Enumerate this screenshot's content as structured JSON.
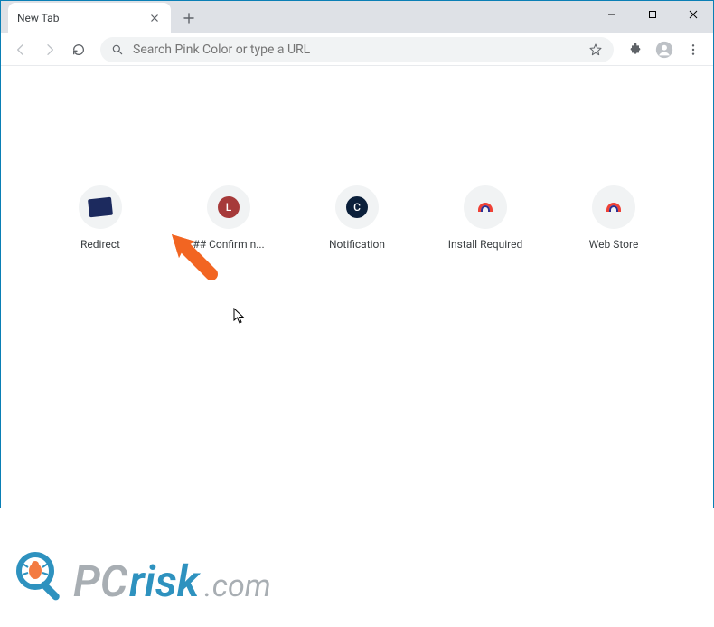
{
  "window": {
    "tab_title": "New Tab"
  },
  "omnibox": {
    "placeholder": "Search Pink Color or type a URL"
  },
  "shortcuts": [
    {
      "label": "Redirect",
      "icon_kind": "image-tile",
      "bg": "#1c2a5e"
    },
    {
      "label": "## Confirm n...",
      "icon_kind": "letter",
      "bg": "#a63a3a",
      "letter": "L"
    },
    {
      "label": "Notification",
      "icon_kind": "letter",
      "bg": "#0b1f3a",
      "letter": "C"
    },
    {
      "label": "Install Required",
      "icon_kind": "rainbow"
    },
    {
      "label": "Web Store",
      "icon_kind": "rainbow"
    }
  ],
  "watermark": {
    "text_pc": "PC",
    "text_risk": "risk",
    "text_com": ".com"
  }
}
